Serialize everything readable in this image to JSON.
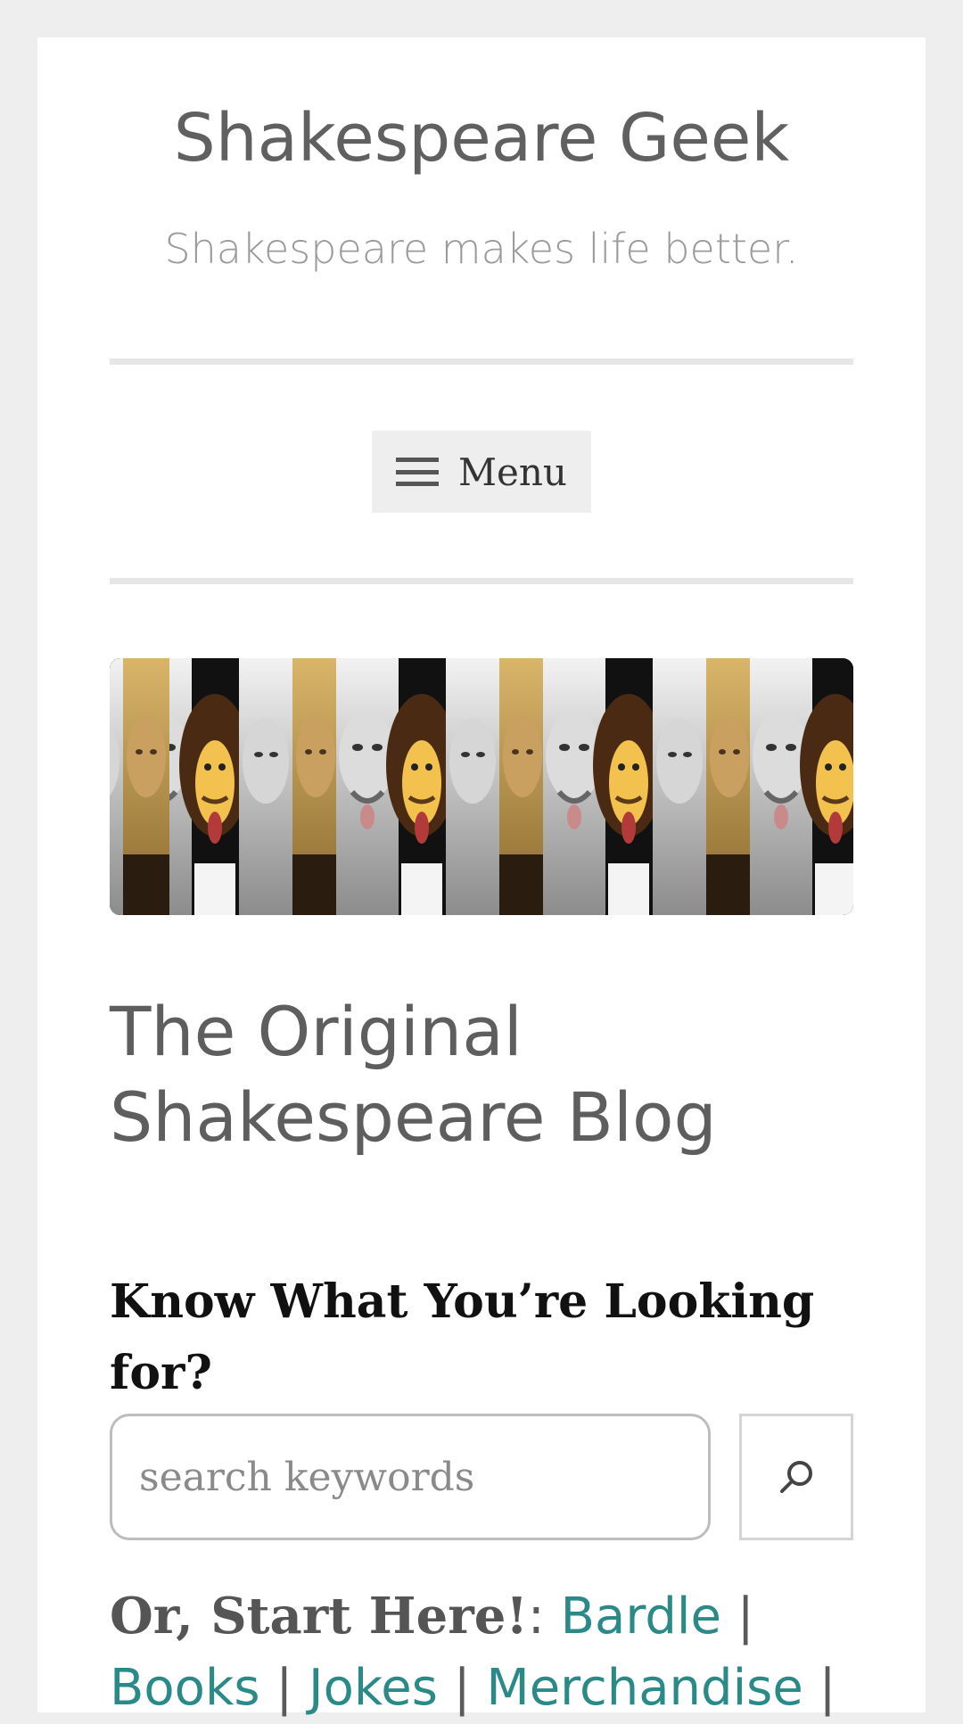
{
  "header": {
    "site_title": "Shakespeare Geek",
    "tagline": "Shakespeare makes life better."
  },
  "nav": {
    "menu_label": "Menu",
    "menu_icon": "hamburger-icon"
  },
  "banner": {
    "alt": "Shakespeare and Einstein mashup banner"
  },
  "post": {
    "title": "The Original Shakespeare Blog"
  },
  "search_widget": {
    "title": "Know What You’re Looking for?",
    "placeholder": "search keywords",
    "button_icon": "search-icon"
  },
  "start_here": {
    "lead": "Or, Start Here!",
    "colon": ":",
    "links": [
      "Bardle",
      "Books",
      "Jokes",
      "Merchandise"
    ],
    "separator": "|"
  },
  "colors": {
    "link": "#2a8a88",
    "background": "#eeeeee"
  }
}
